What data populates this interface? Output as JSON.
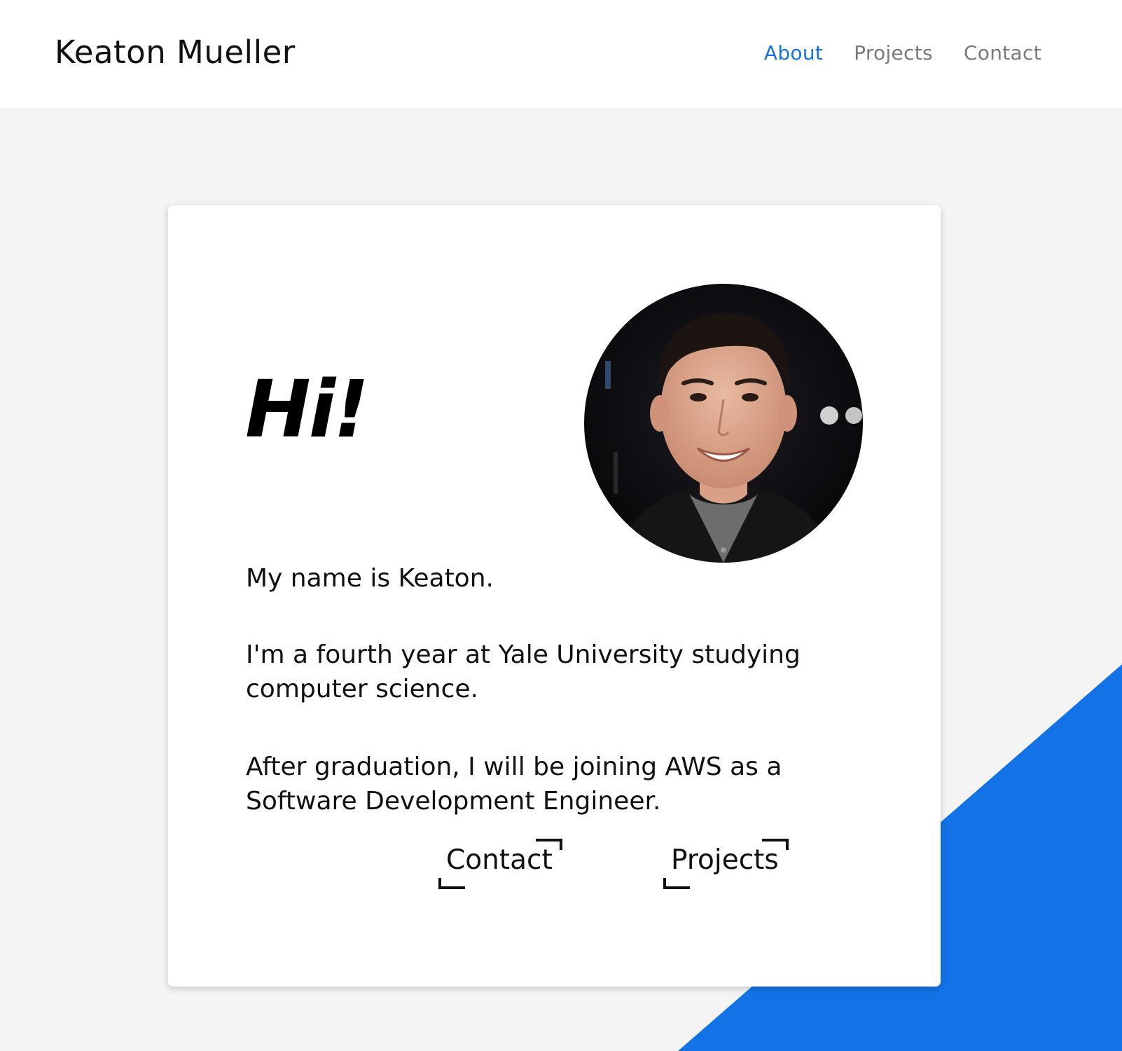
{
  "header": {
    "site_name": "Keaton Mueller",
    "nav": [
      {
        "label": "About",
        "active": true
      },
      {
        "label": "Projects",
        "active": false
      },
      {
        "label": "Contact",
        "active": false
      }
    ]
  },
  "card": {
    "greeting": "Hi!",
    "photo": "portrait-photo",
    "paragraphs": [
      "My name is Keaton.",
      "I'm a fourth year at Yale University studying computer science.",
      "After graduation, I will be joining AWS as a Software Development Engineer."
    ],
    "links": [
      {
        "label": "Contact"
      },
      {
        "label": "Projects"
      }
    ]
  },
  "colors": {
    "accent": "#1373e6",
    "nav_inactive": "#7a7a7a",
    "background": "#f4f4f4",
    "card": "#ffffff",
    "text": "#111111"
  }
}
